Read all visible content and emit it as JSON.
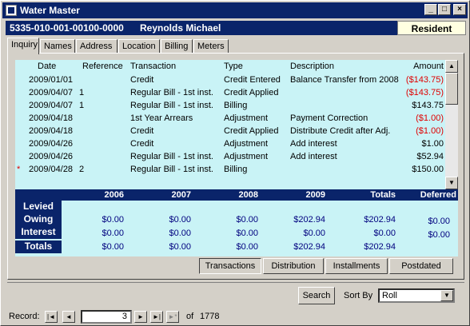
{
  "window": {
    "title": "Water Master"
  },
  "header": {
    "account": "5335-010-001-00100-0000",
    "owner": "Reynolds Michael",
    "status_badge": "Resident"
  },
  "tabs": [
    "Inquiry",
    "Names",
    "Address",
    "Location",
    "Billing",
    "Meters"
  ],
  "grid": {
    "headers": {
      "date": "Date",
      "reference": "Reference",
      "transaction": "Transaction",
      "type": "Type",
      "description": "Description",
      "amount": "Amount"
    },
    "rows": [
      {
        "date": "2009/01/01",
        "reference": "",
        "transaction": "Credit",
        "type": "Credit Entered",
        "description": "Balance Transfer from 2008",
        "amount": "($143.75)"
      },
      {
        "date": "2009/04/07",
        "reference": "1",
        "transaction": "Regular Bill - 1st inst.",
        "type": "Credit Applied",
        "description": "",
        "amount": "($143.75)"
      },
      {
        "date": "2009/04/07",
        "reference": "1",
        "transaction": "Regular Bill - 1st inst.",
        "type": "Billing",
        "description": "",
        "amount": "$143.75"
      },
      {
        "date": "2009/04/18",
        "reference": "",
        "transaction": "1st Year Arrears",
        "type": "Adjustment",
        "description": "Payment Correction",
        "amount": "($1.00)"
      },
      {
        "date": "2009/04/18",
        "reference": "",
        "transaction": "Credit",
        "type": "Credit Applied",
        "description": "Distribute Credit after Adj.",
        "amount": "($1.00)"
      },
      {
        "date": "2009/04/26",
        "reference": "",
        "transaction": "Credit",
        "type": "Adjustment",
        "description": "Add interest",
        "amount": "$1.00"
      },
      {
        "date": "2009/04/26",
        "reference": "",
        "transaction": "Regular Bill - 1st inst.",
        "type": "Adjustment",
        "description": "Add interest",
        "amount": "$52.94"
      },
      {
        "date": "2009/04/28",
        "reference": "2",
        "transaction": "Regular Bill - 1st inst.",
        "type": "Billing",
        "description": "",
        "amount": "$150.00"
      }
    ],
    "new_row_marker": "*"
  },
  "summary": {
    "columns": [
      "2006",
      "2007",
      "2008",
      "2009",
      "Totals",
      "Deferred"
    ],
    "rows": [
      {
        "label": "Levied",
        "values": []
      },
      {
        "label": "Owing",
        "values": [
          "$0.00",
          "$0.00",
          "$0.00",
          "$202.94",
          "$202.94",
          "$0.00"
        ]
      },
      {
        "label": "Interest",
        "values": [
          "$0.00",
          "$0.00",
          "$0.00",
          "$0.00",
          "$0.00",
          "$0.00"
        ]
      },
      {
        "label": "Totals",
        "values": [
          "$0.00",
          "$0.00",
          "$0.00",
          "$202.94",
          "$202.94",
          ""
        ]
      }
    ]
  },
  "view_buttons": [
    "Transactions",
    "Distribution",
    "Installments",
    "Postdated"
  ],
  "search": {
    "button": "Search",
    "sort_label": "Sort By",
    "sort_value": "Roll"
  },
  "record_nav": {
    "label": "Record:",
    "current": "3",
    "of_label": "of",
    "total": "1778"
  },
  "colors": {
    "title_bg": "#0a246a",
    "grid_bg": "#c9f3f6",
    "negative": "#e00000",
    "badge_bg": "#ffffe1"
  }
}
